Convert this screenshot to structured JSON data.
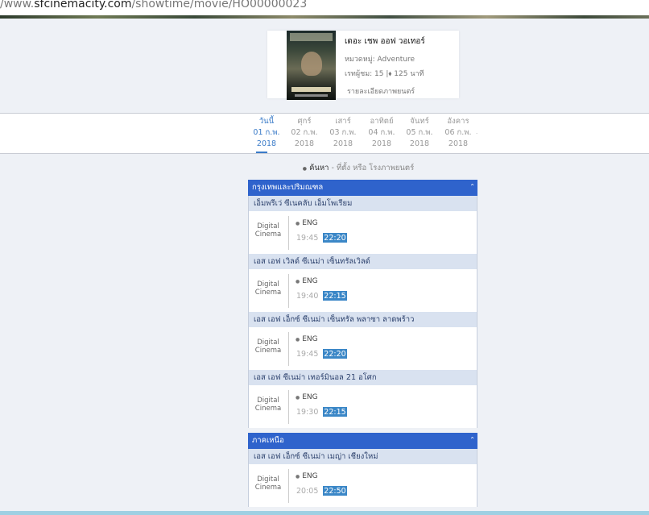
{
  "browser": {
    "url_prefix": "/www.",
    "url_host": "sfcinemacity.com",
    "url_path": "/showtime/movie/HO00000023"
  },
  "movie": {
    "title": "เดอะ เชพ ออฟ วอเทอร์",
    "genre": "หมวดหมู่: Adventure",
    "rating": "เรทผู้ชม: 15 |⬧ 125 นาที",
    "detail_link": "รายละเอียดภาพยนตร์"
  },
  "dates": [
    {
      "day": "วันนี้",
      "date": "01 ก.พ.",
      "year": "2018",
      "active": true
    },
    {
      "day": "ศุกร์",
      "date": "02 ก.พ.",
      "year": "2018"
    },
    {
      "day": "เสาร์",
      "date": "03 ก.พ.",
      "year": "2018"
    },
    {
      "day": "อาทิตย์",
      "date": "04 ก.พ.",
      "year": "2018"
    },
    {
      "day": "จันทร์",
      "date": "05 ก.พ.",
      "year": "2018"
    },
    {
      "day": "อังคาร",
      "date": "06 ก.พ.",
      "year": "2018"
    }
  ],
  "search": {
    "bullet": "●",
    "label": "ค้นหา",
    "hint": " - ที่ตั้ง หรือ โรงภาพยนตร์"
  },
  "regions": [
    {
      "name": "กรุงเทพและปริมณฑล",
      "cinemas": [
        {
          "name": "เอ็มพรีเว่ ซีเนคลับ เอ็มโพเรียม",
          "format": [
            "Digital",
            "Cinema"
          ],
          "lang": "ENG",
          "past_time": "19:45",
          "next_time": "22:20"
        },
        {
          "name": "เอส เอฟ เวิลด์ ซีเนม่า เซ็นทรัลเวิลด์",
          "format": [
            "Digital",
            "Cinema"
          ],
          "lang": "ENG",
          "past_time": "19:40",
          "next_time": "22:15"
        },
        {
          "name": "เอส เอฟ เอ็กซ์ ซีเนม่า เซ็นทรัล พลาซา ลาดพร้าว",
          "format": [
            "Digital",
            "Cinema"
          ],
          "lang": "ENG",
          "past_time": "19:45",
          "next_time": "22:20"
        },
        {
          "name": "เอส เอฟ ซีเนม่า เทอร์มินอล 21 อโศก",
          "format": [
            "Digital",
            "Cinema"
          ],
          "lang": "ENG",
          "past_time": "19:30",
          "next_time": "22:15"
        }
      ]
    },
    {
      "name": "ภาคเหนือ",
      "cinemas": [
        {
          "name": "เอส เอฟ เอ็กซ์ ซีเนม่า เมญ่า เชียงใหม่",
          "format": [
            "Digital",
            "Cinema"
          ],
          "lang": "ENG",
          "past_time": "20:05",
          "next_time": "22:50"
        }
      ]
    }
  ],
  "colors": {
    "region_header": "#2f63cc",
    "cinema_header": "#d9e2f0",
    "active_date": "#3a7bc8",
    "next_showtime": "#3b87c7"
  }
}
